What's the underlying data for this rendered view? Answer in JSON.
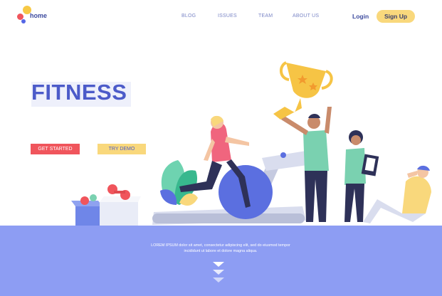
{
  "header": {
    "logo_text": "home",
    "nav": [
      "BLOG",
      "ISSUES",
      "TEAM",
      "ABOUT US"
    ],
    "login_label": "Login",
    "signup_label": "Sign Up"
  },
  "hero": {
    "title": "FITNESS",
    "get_started_label": "GET STARTED",
    "try_demo_label": "TRY DEMO"
  },
  "footer": {
    "body_line1": "LOREM IPSUM dolor sit amet, consectetur adipiscing elit, sed do eiusmod tempor",
    "body_line2": "incididunt ut labore et dolore magna aliqua."
  },
  "colors": {
    "accent_blue": "#4c5bc9",
    "band_blue": "#8d9df3",
    "red": "#f0555c",
    "yellow": "#f9d87c"
  }
}
